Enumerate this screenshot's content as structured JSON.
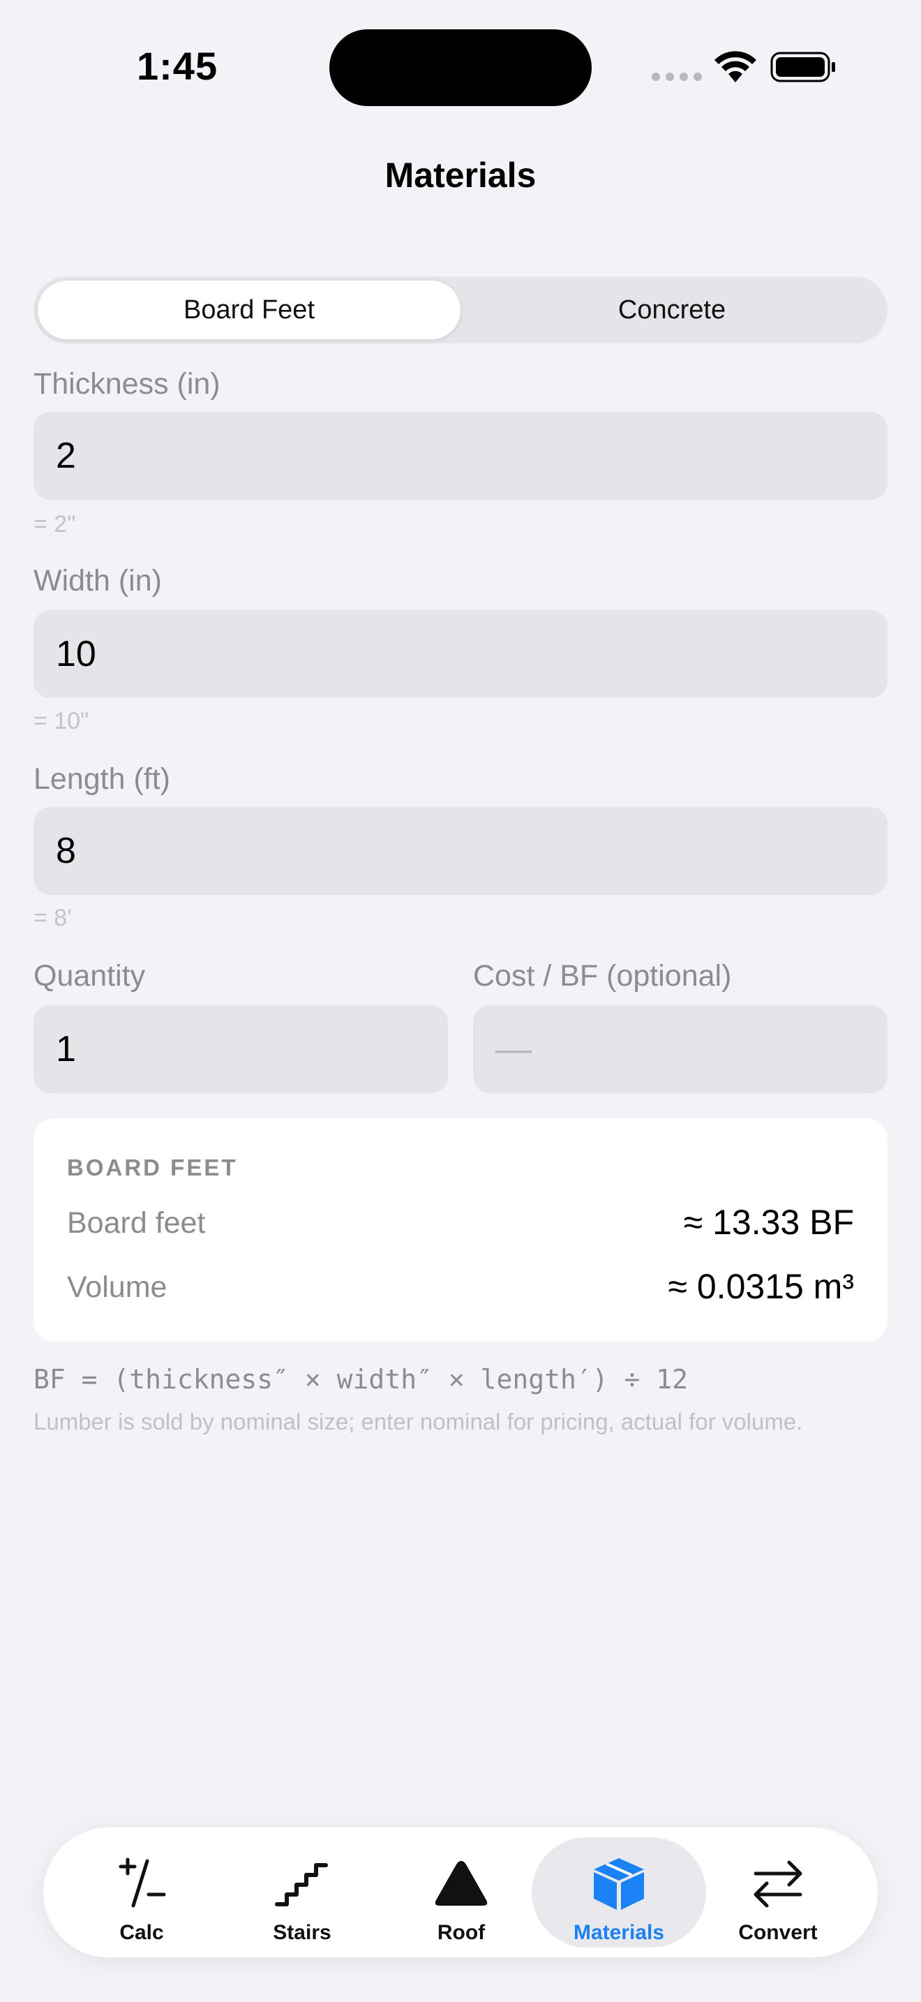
{
  "status": {
    "time": "1:45"
  },
  "nav": {
    "title": "Materials"
  },
  "segmented": {
    "options": [
      "Board Feet",
      "Concrete"
    ],
    "selected": "Board Feet"
  },
  "fields": {
    "thickness": {
      "label": "Thickness (in)",
      "value": "2",
      "hint": "= 2\""
    },
    "width": {
      "label": "Width (in)",
      "value": "10",
      "hint": "= 10\""
    },
    "length": {
      "label": "Length (ft)",
      "value": "8",
      "hint": "= 8'"
    },
    "quantity": {
      "label": "Quantity",
      "value": "1"
    },
    "cost": {
      "label": "Cost / BF (optional)",
      "placeholder": "—"
    }
  },
  "result": {
    "heading": "BOARD FEET",
    "rows": [
      {
        "label": "Board feet",
        "value": "≈ 13.33 BF"
      },
      {
        "label": "Volume",
        "value": "≈ 0.0315 m³"
      }
    ]
  },
  "formula": "BF = (thickness″ × width″ × length′) ÷ 12",
  "footnote": "Lumber is sold by nominal size; enter nominal for pricing, actual for volume.",
  "tabs": [
    {
      "label": "Calc",
      "icon": "plus-minus-icon"
    },
    {
      "label": "Stairs",
      "icon": "stairs-icon"
    },
    {
      "label": "Roof",
      "icon": "triangle-icon"
    },
    {
      "label": "Materials",
      "icon": "cube-icon",
      "active": true
    },
    {
      "label": "Convert",
      "icon": "arrows-left-right-icon"
    }
  ],
  "colors": {
    "accent": "#1a82f5",
    "background": "#f2f2f7",
    "field": "#e4e4e9"
  }
}
